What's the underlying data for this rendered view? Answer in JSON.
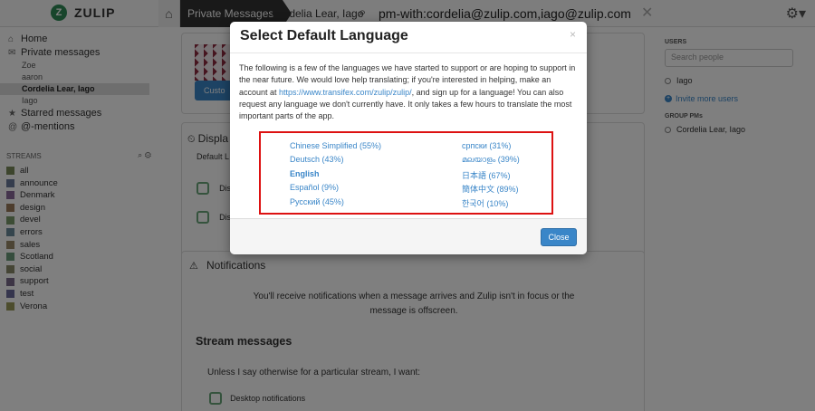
{
  "topbar": {
    "logo_letter": "Z",
    "logo_text": "ZULIP",
    "crumb_private": "Private Messages",
    "crumb_names": "Cordelia Lear, Iago",
    "search_text": "pm-with:cordelia@zulip.com,iago@zulip.com"
  },
  "left": {
    "home": "Home",
    "private_messages": "Private messages",
    "pm_users": [
      "Zoe",
      "aaron",
      "Cordelia Lear, Iago",
      "Iago"
    ],
    "starred": "Starred messages",
    "mentions": "@-mentions",
    "streams_label": "STREAMS",
    "streams": [
      {
        "name": "all",
        "color": "#7a8a5a"
      },
      {
        "name": "announce",
        "color": "#6a7a9a"
      },
      {
        "name": "Denmark",
        "color": "#8a6a9a"
      },
      {
        "name": "design",
        "color": "#9a7a5a"
      },
      {
        "name": "devel",
        "color": "#7a9a6a"
      },
      {
        "name": "errors",
        "color": "#6a8a9a"
      },
      {
        "name": "sales",
        "color": "#9a8a6a"
      },
      {
        "name": "Scotland",
        "color": "#6a9a7a"
      },
      {
        "name": "social",
        "color": "#8a8a6a"
      },
      {
        "name": "support",
        "color": "#7a6a8a"
      },
      {
        "name": "test",
        "color": "#6a6a9a"
      },
      {
        "name": "Verona",
        "color": "#9a9a5a"
      }
    ]
  },
  "center": {
    "custom_button": "Custo",
    "display_title": "Displa",
    "default_lang_label": "Default L",
    "display_opt1": "Disp",
    "display_opt2": "Disp",
    "notifications_title": "Notifications",
    "notif_body_line1": "You'll receive notifications when a message arrives and Zulip isn't in focus or the",
    "notif_body_line2": "message is offscreen.",
    "stream_messages": "Stream messages",
    "unless": "Unless I say otherwise for a particular stream, I want:",
    "desktop_notifications": "Desktop notifications"
  },
  "right": {
    "users_label": "USERS",
    "search_placeholder": "Search people",
    "user": "Iago",
    "invite": "Invite more users",
    "group_pms_label": "GROUP PMs",
    "group_pm": "Cordelia Lear, Iago"
  },
  "modal": {
    "title": "Select Default Language",
    "close_x": "×",
    "intro_1": "The following is a few of the languages we have started to support or are hoping to support in the near future. We would love help translating; if you're interested in helping, make an account at ",
    "link": "https://www.transifex.com/zulip/zulip/",
    "intro_2": ", and sign up for a language! You can also request any language we don't currently have. It only takes a few hours to translate the most important parts of the app.",
    "languages_left": [
      {
        "label": "Chinese Simplified (55%)",
        "current": false
      },
      {
        "label": "Deutsch (43%)",
        "current": false
      },
      {
        "label": "English",
        "current": true
      },
      {
        "label": "Español (9%)",
        "current": false
      },
      {
        "label": "Русский (45%)",
        "current": false
      }
    ],
    "languages_right": [
      {
        "label": "српски (31%)",
        "current": false
      },
      {
        "label": "മലയാളം (39%)",
        "current": false
      },
      {
        "label": "日本語 (67%)",
        "current": false
      },
      {
        "label": "簡体中文 (89%)",
        "current": false
      },
      {
        "label": "한국어 (10%)",
        "current": false
      }
    ],
    "close_button": "Close"
  }
}
